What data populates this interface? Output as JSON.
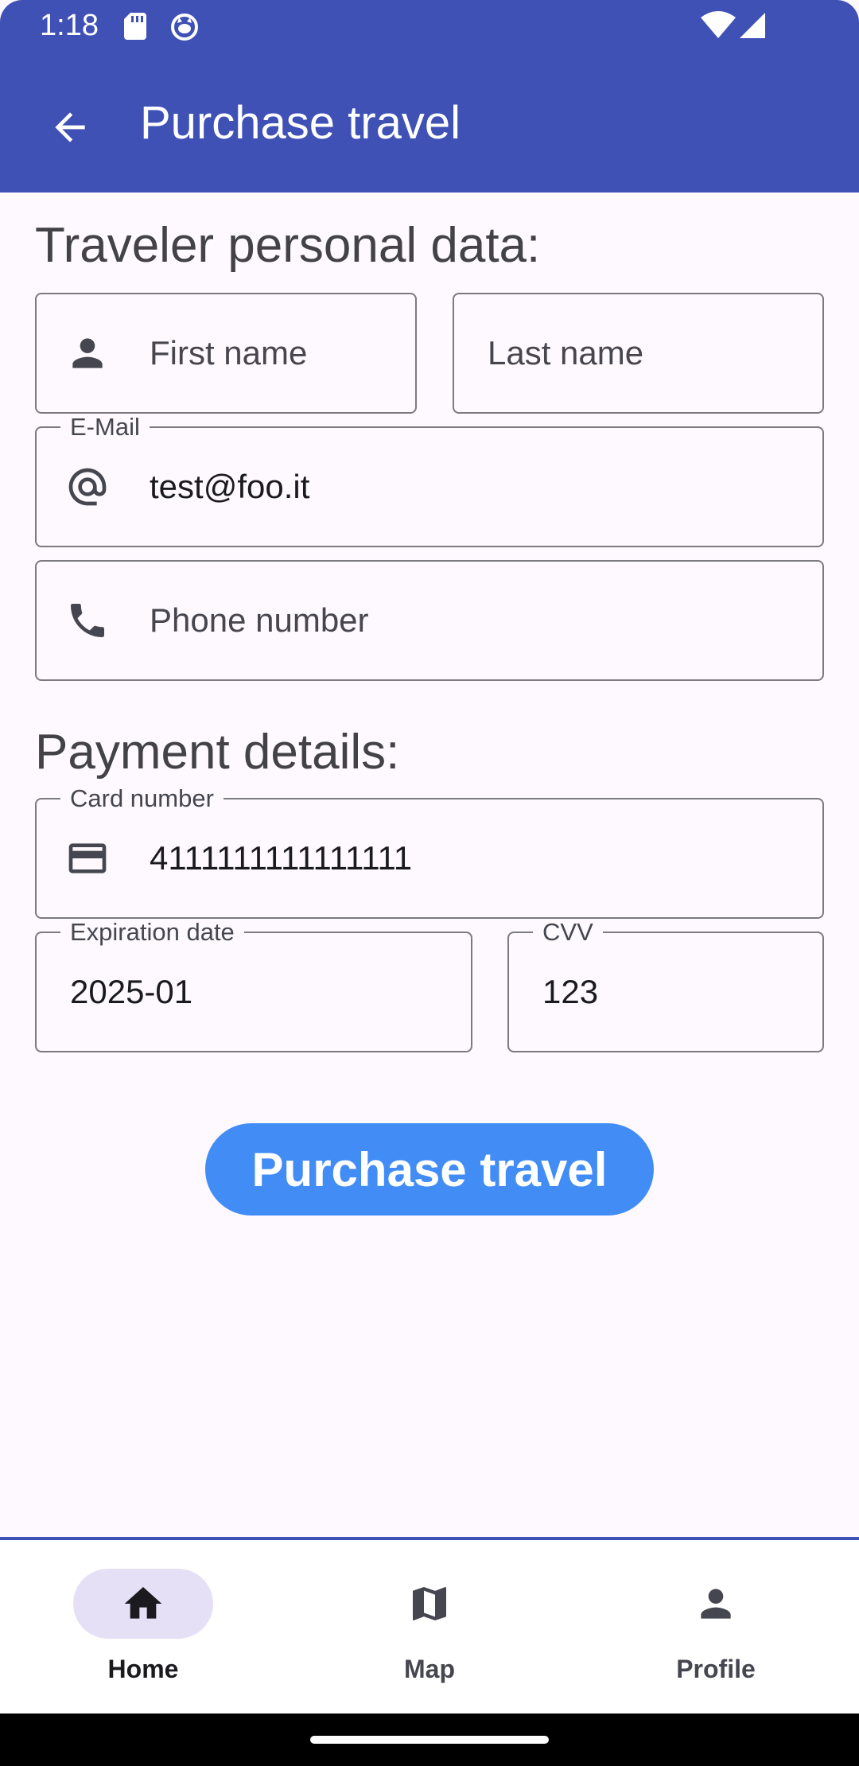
{
  "status_bar": {
    "time": "1:18",
    "icons": [
      "sd-card-icon",
      "cat-notification-icon",
      "wifi-icon",
      "signal-icon"
    ]
  },
  "app_bar": {
    "title": "Purchase travel",
    "back_icon": "arrow-back-icon",
    "background_color": "#3f51b5"
  },
  "traveler_section": {
    "heading": "Traveler personal data:",
    "first_name": {
      "label": "",
      "placeholder": "First name",
      "value": "",
      "icon": "person-icon"
    },
    "last_name": {
      "label": "",
      "placeholder": "Last name",
      "value": ""
    },
    "email": {
      "label": "E-Mail",
      "value": "test@foo.it",
      "icon": "at-sign-icon"
    },
    "phone": {
      "label": "",
      "placeholder": "Phone number",
      "value": "",
      "icon": "phone-icon"
    }
  },
  "payment_section": {
    "heading": "Payment details:",
    "card_number": {
      "label": "Card number",
      "value": "4111111111111111",
      "icon": "credit-card-icon"
    },
    "expiration": {
      "label": "Expiration date",
      "value": "2025-01"
    },
    "cvv": {
      "label": "CVV",
      "value": "123"
    }
  },
  "purchase_button": {
    "label": "Purchase travel",
    "color": "#428cf6"
  },
  "bottom_nav": {
    "items": [
      {
        "label": "Home",
        "icon": "home-icon",
        "active": true
      },
      {
        "label": "Map",
        "icon": "map-icon",
        "active": false
      },
      {
        "label": "Profile",
        "icon": "person-icon",
        "active": false
      }
    ],
    "active_indicator_color": "#e6e0f6"
  }
}
